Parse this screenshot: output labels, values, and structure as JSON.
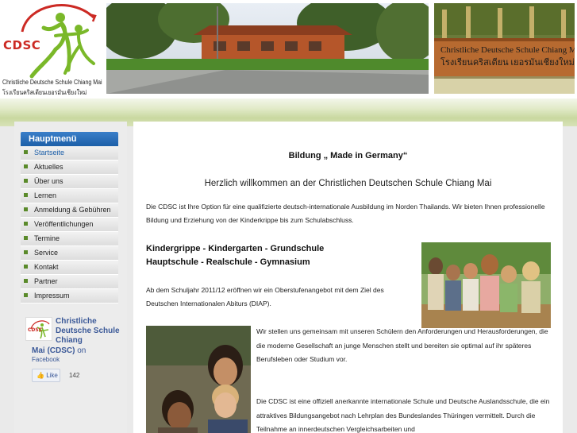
{
  "header": {
    "logo_abbr": "CDSC",
    "logo_name": "Christliche Deutsche Schule Chiang Mai",
    "logo_thai": "โรงเรียนคริสเตียนเยอรมันเชียงใหม่",
    "sign_text": "Christliche Deutsche Schule Chiang Mai",
    "sign_thai": "โรงเรียนคริสเตียน เยอรมันเชียงใหม่"
  },
  "sidebar": {
    "menu_title": "Hauptmenü",
    "items": [
      {
        "label": "Startseite"
      },
      {
        "label": "Aktuelles"
      },
      {
        "label": "Über uns"
      },
      {
        "label": "Lernen"
      },
      {
        "label": "Anmeldung & Gebühren"
      },
      {
        "label": "Veröffentlichungen"
      },
      {
        "label": "Termine"
      },
      {
        "label": "Service"
      },
      {
        "label": "Kontakt"
      },
      {
        "label": "Partner"
      },
      {
        "label": "Impressum"
      }
    ],
    "facebook": {
      "title": "Christliche Deutsche Schule Chiang",
      "title_cont": "Mai (CDSC)",
      "on": "on",
      "facebook": "Facebook",
      "like": "Like",
      "count": "142",
      "logo_text": "CDSC"
    }
  },
  "content": {
    "title": "Bildung „ Made in Germany“",
    "welcome": "Herzlich willkommen an der Christlichen Deutschen Schule Chiang Mai",
    "intro": "Die CDSC ist Ihre Option für eine qualifizierte deutsch-internationale Ausbildung im Norden Thailands. Wir bieten Ihnen professionelle Bildung und Erziehung von der Kinderkrippe bis zum Schulabschluss.",
    "schools_line1": "Kindergrippe - Kindergarten - Grundschule",
    "schools_line2": "Hauptschule - Realschule - Gymnasium",
    "abitur": "Ab dem Schuljahr 2011/12 eröffnen wir ein Oberstufenangebot mit dem Ziel des Deutschen Internationalen Abiturs (DIAP).",
    "challenges": "Wir stellen uns gemeinsam mit unseren Schülern den Anforderungen und Herausforderungen, die die moderne Gesellschaft an junge Menschen stellt und bereiten sie optimal auf ihr späteres Berufsleben oder Studium vor.",
    "recognised": "Die CDSC ist eine offiziell anerkannte internationale Schule und Deutsche Auslandsschule, die ein attraktives Bildungsangebot nach Lehrplan des Bundeslandes Thüringen vermittelt. Durch die Teilnahme an innerdeutschen Vergleichsarbeiten und"
  },
  "colors": {
    "menu_header": "#1d5fa8",
    "logo_red": "#cc2a24",
    "logo_green": "#7ab829",
    "facebook_blue": "#3b5998"
  }
}
